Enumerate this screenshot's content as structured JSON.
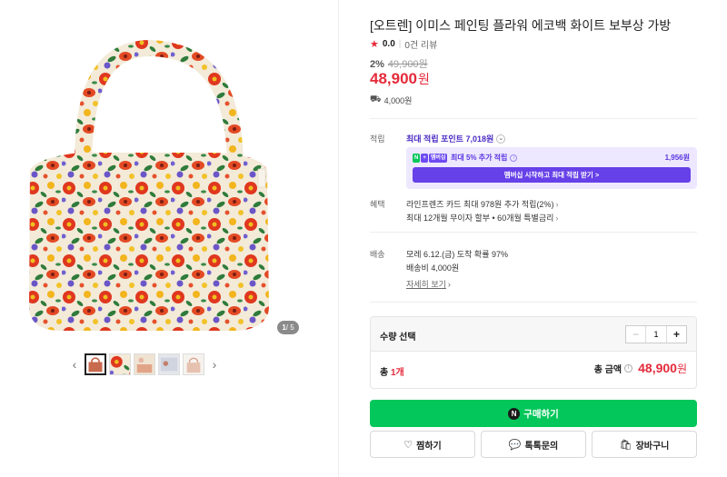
{
  "product": {
    "title": "[오트렌] 이미스 페인팅 플라워 에코백 화이트 보부상 가방",
    "rating_score": "0.0",
    "review_count": "0건 리뷰",
    "discount_rate": "2%",
    "original_price": "49,900원",
    "price": "48,900",
    "price_unit": "원",
    "shipping_fee": "4,000원"
  },
  "gallery": {
    "counter_current": "1",
    "counter_total": "/ 5",
    "thumbnail_count": 5
  },
  "points": {
    "label": "적립",
    "max_points": "최대 적립 포인트 7,018원",
    "badge_n": "N",
    "badge_plus": "+",
    "badge_membership": "멤버십",
    "extra_text": "최대 5% 추가 적립",
    "extra_value": "1,956원",
    "membership_button": "멤버십 시작하고 최대 적립 받기 >"
  },
  "benefits": {
    "label": "혜택",
    "items": [
      "라인프렌즈 카드 최대 978원 추가 적립(2%)",
      "최대 12개월 무이자 할부 • 60개월 특별금리"
    ]
  },
  "delivery": {
    "label": "배송",
    "arrival": "모레 6.12.(금) 도착 확률 97%",
    "fee": "배송비 4,000원",
    "more_link": "자세히 보기"
  },
  "purchase": {
    "qty_label": "수량 선택",
    "qty_value": "1",
    "total_count_prefix": "총 ",
    "total_count_num": "1개",
    "total_amount_label": "총 금액",
    "total_amount_value": "48,900",
    "total_amount_unit": "원",
    "buy_button": "구매하기",
    "wish_button": "찜하기",
    "talk_button": "톡톡문의",
    "cart_button": "장바구니"
  },
  "colors": {
    "accent_red": "#e5293a",
    "naver_green": "#03c75a",
    "membership_purple": "#6640e8"
  }
}
